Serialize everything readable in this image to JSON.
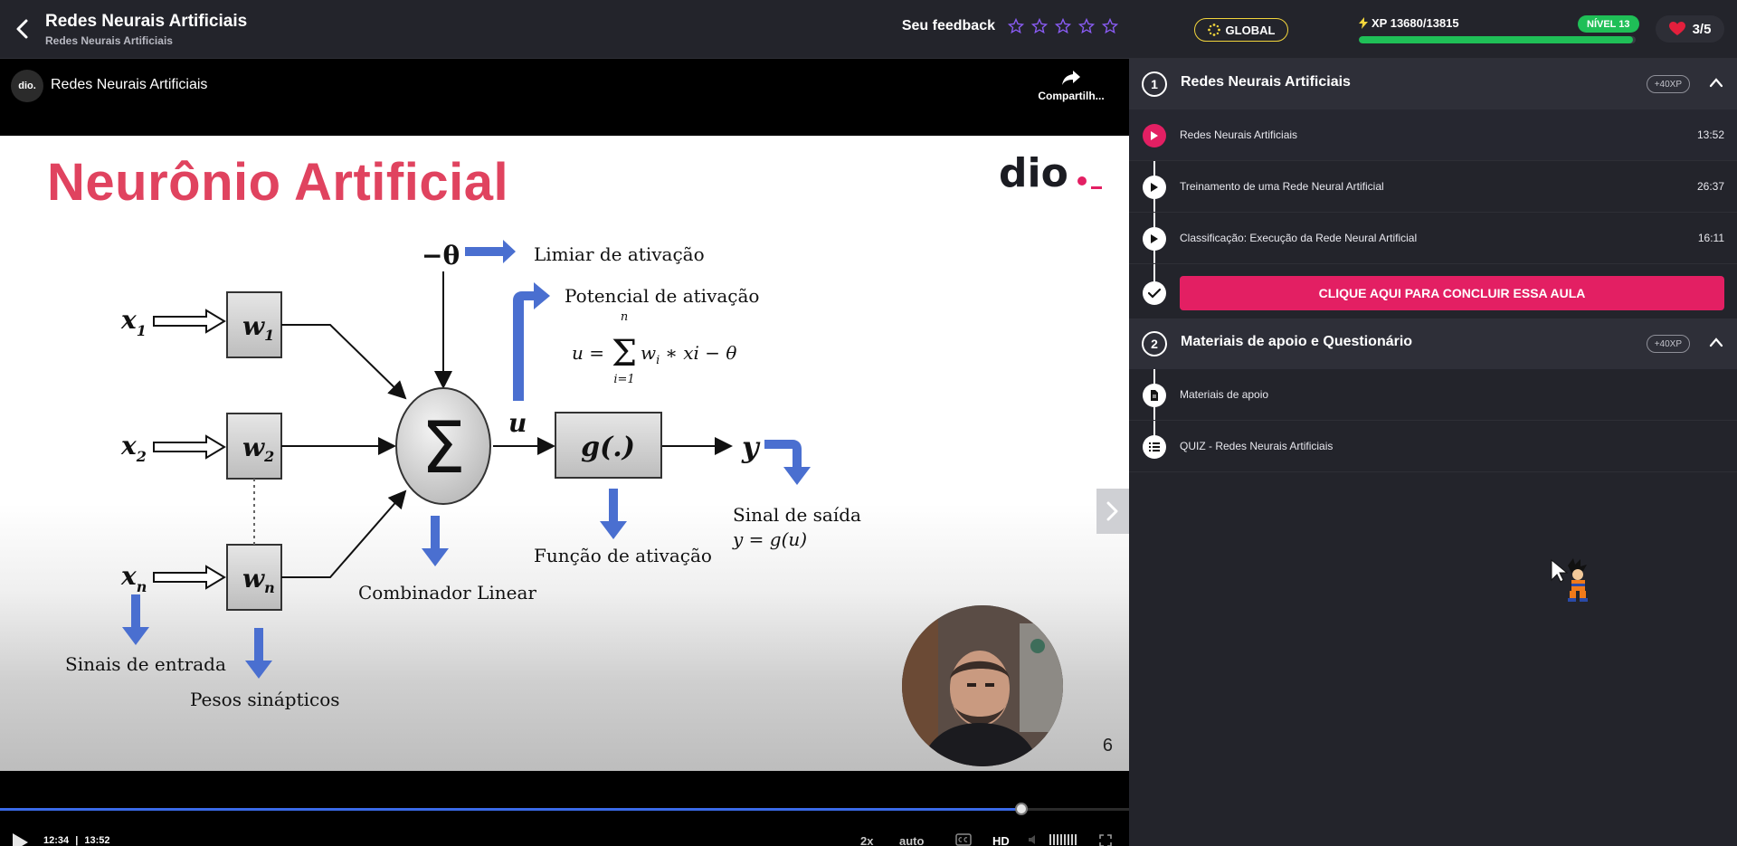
{
  "header": {
    "title": "Redes Neurais Artificiais",
    "subtitle": "Redes Neurais Artificiais",
    "feedback_label": "Seu feedback",
    "rating_max": 5,
    "rating_value": 0
  },
  "stats": {
    "global_label": "GLOBAL",
    "xp_label": "XP 13680/13815",
    "xp_current": 13680,
    "xp_total": 13815,
    "level_label": "NÍVEL 13",
    "lives_label": "3/5"
  },
  "player": {
    "channel_avatar_text": "dio.",
    "video_title": "Redes Neurais Artificiais",
    "share_label": "Compartilh...",
    "current_time": "12:34",
    "separator": "|",
    "duration": "13:52",
    "progress_fraction": 0.905,
    "speed_label": "2x",
    "quality_auto_label": "auto",
    "hd_label": "HD"
  },
  "slide": {
    "title": "Neurônio Artificial",
    "logo_text": "dio._",
    "page_number": "6",
    "labels": {
      "theta": "−θ",
      "threshold": "Limiar de ativação",
      "potential": "Potencial de ativação",
      "formula_lhs": "u =",
      "formula_sum_top": "n",
      "formula_sum_bottom": "i=1",
      "formula_rhs": "w",
      "formula_sub": "i",
      "formula_tail": "∗ xi − θ",
      "x1": "x",
      "x1_sub": "1",
      "x2": "x",
      "x2_sub": "2",
      "xn": "x",
      "xn_sub": "n",
      "w1": "w",
      "w1_sub": "1",
      "w2": "w",
      "w2_sub": "2",
      "wn": "w",
      "wn_sub": "n",
      "sigma": "Σ",
      "u": "u",
      "g": "g(.)",
      "y": "y",
      "output_signal": "Sinal de saída",
      "output_formula": "y = g(u)",
      "activation_function": "Função de ativação",
      "linear_combiner": "Combinador Linear",
      "input_signals": "Sinais de entrada",
      "synaptic_weights": "Pesos sinápticos"
    }
  },
  "sections": [
    {
      "number": "1",
      "title": "Redes Neurais Artificiais",
      "xp": "+40XP",
      "lessons": [
        {
          "title": "Redes Neurais Artificiais",
          "duration": "13:52",
          "icon": "play-icon",
          "active": true
        },
        {
          "title": "Treinamento de uma Rede Neural Artificial",
          "duration": "26:37",
          "icon": "play-icon",
          "active": false
        },
        {
          "title": "Classificação: Execução da Rede Neural Artificial",
          "duration": "16:11",
          "icon": "play-icon",
          "active": false
        }
      ],
      "conclude_label": "CLIQUE AQUI PARA CONCLUIR ESSA AULA"
    },
    {
      "number": "2",
      "title": "Materiais de apoio e Questionário",
      "xp": "+40XP",
      "lessons": [
        {
          "title": "Materiais de apoio",
          "icon": "document-icon"
        },
        {
          "title": "QUIZ - Redes Neurais Artificiais",
          "icon": "list-icon"
        }
      ]
    }
  ],
  "colors": {
    "accent_pink": "#e31f63",
    "slide_title": "#e0435f",
    "xp_green": "#1fbf57",
    "global_yellow": "#f2d53c",
    "diagram_blue": "#4a6fd0"
  }
}
